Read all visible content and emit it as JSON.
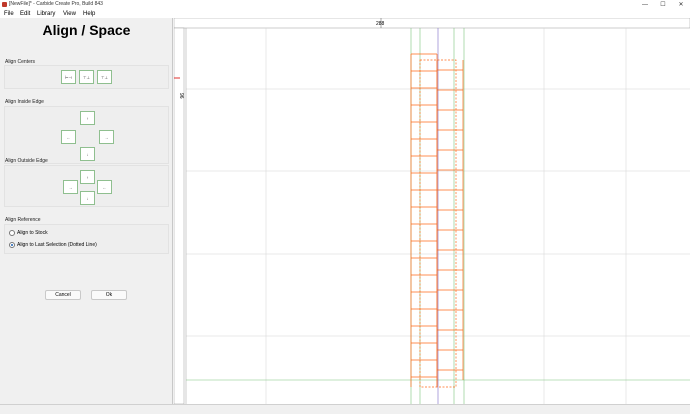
{
  "window": {
    "title": "[NewFile]* - Carbide Create Pro, Build 843",
    "minimize_glyph": "—",
    "maximize_glyph": "☐",
    "close_glyph": "✕"
  },
  "menu": [
    {
      "label": "File"
    },
    {
      "label": "Edit"
    },
    {
      "label": "Library"
    },
    {
      "label": "View"
    },
    {
      "label": "Help"
    }
  ],
  "panel": {
    "title": "Align / Space",
    "align_centers_label": "Align Centers",
    "align_inside_label": "Align Inside Edge",
    "align_outside_label": "Align Outside Edge",
    "align_reference_label": "Align Reference",
    "reference_options": [
      {
        "label": "Align to Stock",
        "checked": false
      },
      {
        "label": "Align to Last Selection (Dotted Line)",
        "checked": true
      }
    ],
    "cancel_label": "Cancel",
    "ok_label": "Ok",
    "glyphs": {
      "center_h": "⊢⊣",
      "center_v": "⊤⊥",
      "top": "↑",
      "left": "←",
      "right": "→",
      "bottom": "↓"
    }
  },
  "ruler": {
    "top_label": "288",
    "left_label": "96"
  },
  "colors": {
    "accent": "#1a5fb4",
    "grid": "#d4d4d4",
    "guide_green": "#7cc47c",
    "shape_orange": "#ff6a1a",
    "ruler_marker": "#e0312e",
    "axis_purple": "#7b68c8"
  }
}
